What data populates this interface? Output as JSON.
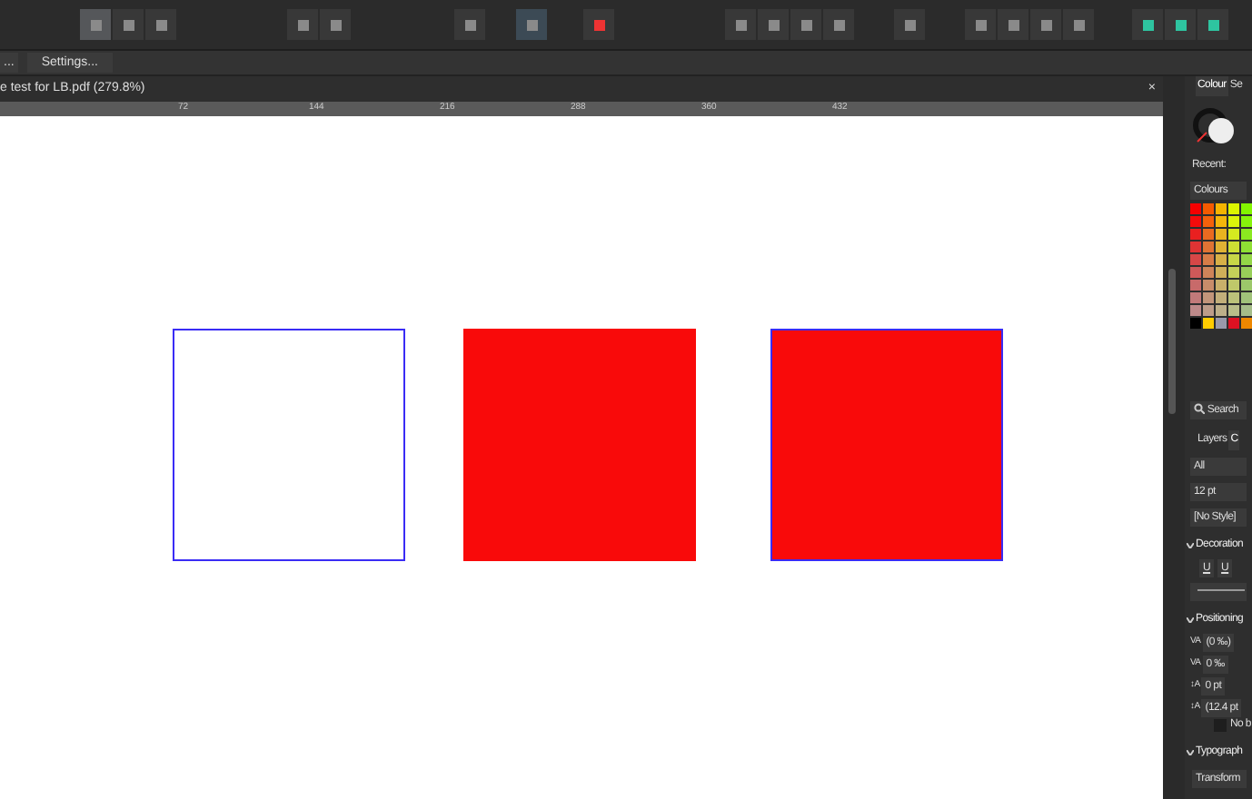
{
  "toolbar": {
    "groups": [
      [
        {
          "selected": true
        },
        {
          "selected": false
        },
        {
          "selected": false
        }
      ],
      [
        {
          "selected": false
        },
        {
          "selected": false
        }
      ],
      [
        {
          "selected": false
        }
      ],
      [
        {
          "selected": true
        }
      ],
      [
        {
          "selected": false
        }
      ],
      [
        {
          "selected": false
        },
        {
          "selected": false
        },
        {
          "selected": false
        },
        {
          "selected": false
        }
      ],
      [
        {
          "selected": false
        }
      ],
      [
        {
          "selected": false
        },
        {
          "selected": false
        },
        {
          "selected": false
        },
        {
          "selected": false
        }
      ],
      [
        {
          "selected": false
        },
        {
          "selected": false
        },
        {
          "selected": false
        }
      ]
    ]
  },
  "context_bar": {
    "buttons": [
      "...",
      "Settings..."
    ]
  },
  "document_tab": {
    "title": "e test for LB.pdf (279.8%)",
    "close": "×"
  },
  "ruler": {
    "labels": [
      "72",
      "144",
      "216",
      "288",
      "360",
      "432"
    ]
  },
  "canvas": {
    "shapes": [
      {
        "color": "#ffffff",
        "outlined": true
      },
      {
        "color": "#f90a0a",
        "outlined": false
      },
      {
        "color": "#f90a0a",
        "outlined": true
      }
    ]
  },
  "right_panel": {
    "tabs": [
      {
        "label": "Colour",
        "selected": true
      },
      {
        "label": "Se",
        "selected": false
      }
    ],
    "recent_label": "Recent:",
    "palette_button": "Colours",
    "search_placeholder": "Search",
    "tabs2": [
      {
        "label": "Layers",
        "selected": false
      },
      {
        "label": "C",
        "selected": true
      }
    ],
    "fields": [
      "All",
      "12 pt",
      "[No Style]"
    ],
    "sections": [
      {
        "title": "Decoration",
        "items": [
          {
            "kind": "buttons",
            "labels": [
              "U",
              "U"
            ]
          },
          {
            "kind": "line"
          }
        ]
      },
      {
        "title": "Positioning",
        "items": [
          {
            "kind": "field",
            "icon": "VA",
            "value": "(0 ‰)"
          },
          {
            "kind": "field",
            "icon": "VA",
            "value": "0 ‰"
          },
          {
            "kind": "field",
            "icon": "↕A",
            "value": "0 pt"
          },
          {
            "kind": "field",
            "icon": "↕A",
            "value": "(12.4 pt"
          },
          {
            "kind": "check",
            "label": "No b",
            "checked": false
          }
        ]
      },
      {
        "title": "Typograph",
        "items": [
          {
            "kind": "tab",
            "label": "Transform"
          }
        ]
      }
    ]
  }
}
